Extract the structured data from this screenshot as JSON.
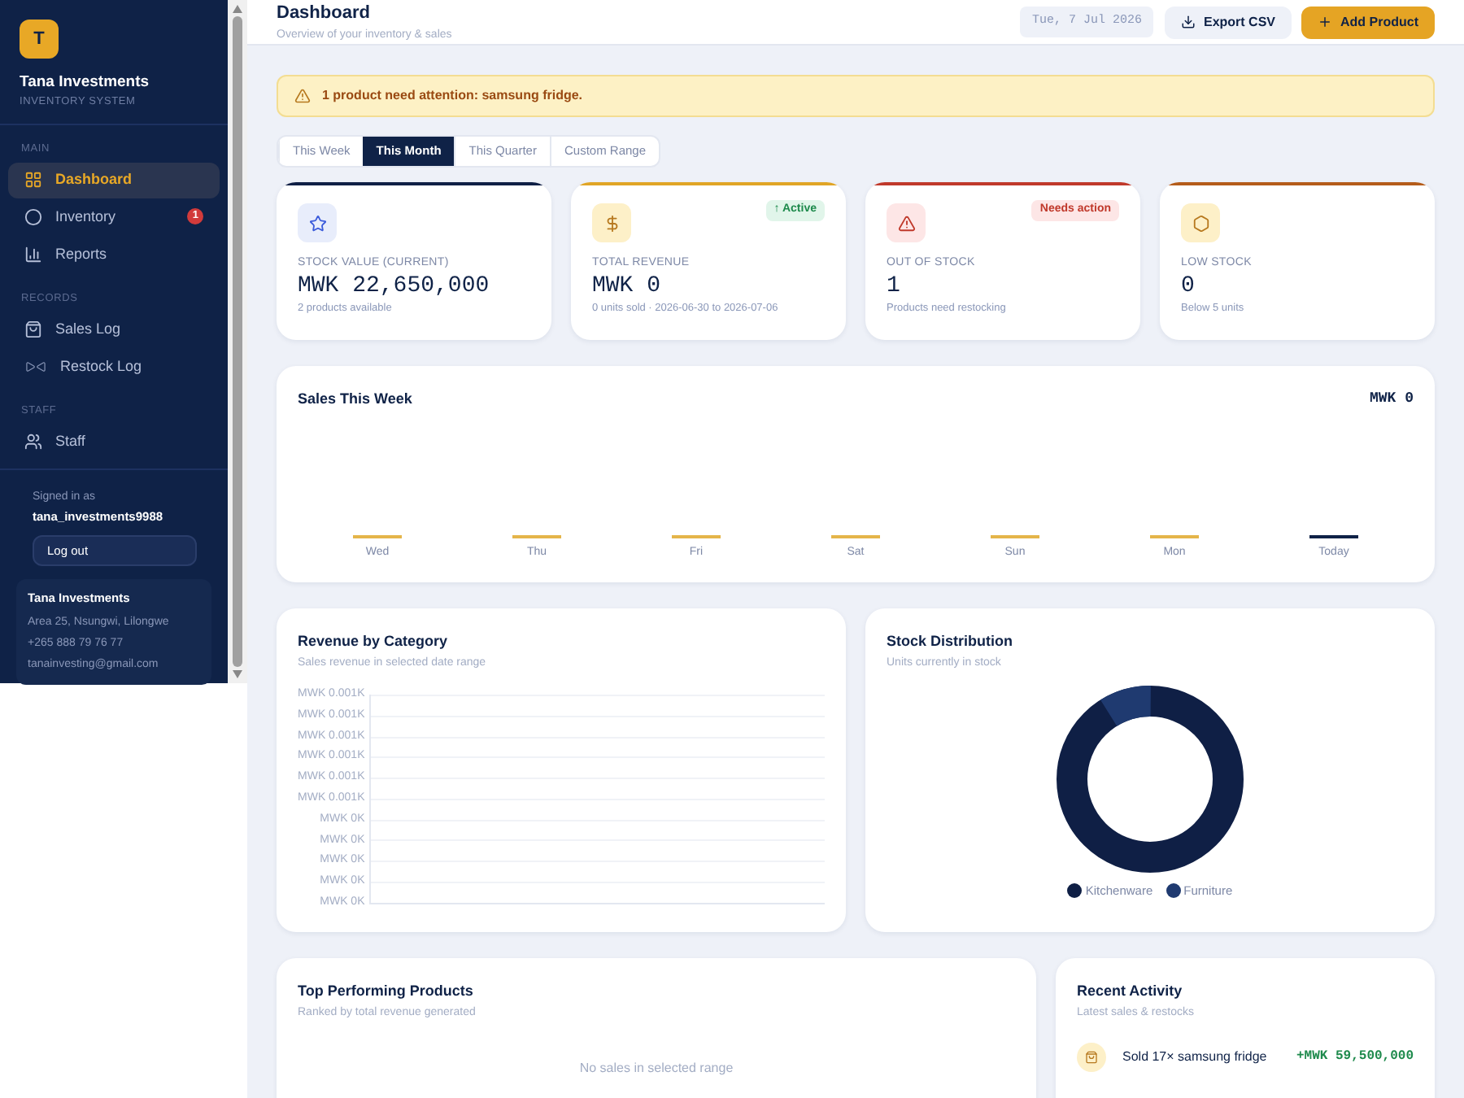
{
  "brand": {
    "logo_letter": "T",
    "name": "Tana Investments",
    "subtitle": "INVENTORY SYSTEM"
  },
  "sidebar": {
    "sections": [
      {
        "heading": "MAIN",
        "items": [
          {
            "label": "Dashboard",
            "kind": "grid",
            "selected": true
          },
          {
            "label": "Inventory",
            "kind": "circle",
            "selected": false,
            "badge": "1"
          },
          {
            "label": "Reports",
            "kind": "bars",
            "selected": false
          }
        ]
      },
      {
        "heading": "RECORDS",
        "items": [
          {
            "label": "Sales Log",
            "kind": "bag",
            "selected": false
          },
          {
            "label": "Restock Log",
            "kind": "arrows",
            "selected": false
          }
        ]
      },
      {
        "heading": "STAFF",
        "items": [
          {
            "label": "Staff",
            "kind": "users",
            "selected": false
          }
        ]
      }
    ],
    "signed_in_label": "Signed in as",
    "username": "tana_investments9988",
    "logout": "Log out",
    "company": {
      "name": "Tana Investments",
      "lines": [
        "Area 25, Nsungwi, Lilongwe",
        "+265 888 79 76 77",
        "tanainvesting@gmail.com"
      ]
    }
  },
  "header": {
    "title": "Dashboard",
    "subtitle": "Overview of your inventory & sales",
    "date": "Tue, 7 Jul 2026",
    "export": "Export CSV",
    "add": "Add Product"
  },
  "alert": "1 product need attention: samsung fridge.",
  "tabs": [
    {
      "label": "This Week",
      "selected": false
    },
    {
      "label": "This Month",
      "selected": true
    },
    {
      "label": "This Quarter",
      "selected": false
    },
    {
      "label": "Custom Range",
      "selected": false
    }
  ],
  "stats": [
    {
      "kind": "star",
      "color": "#0f1f45",
      "label": "STOCK VALUE (CURRENT)",
      "value": "MWK 22,650,000",
      "note": "2 products available"
    },
    {
      "kind": "dollar",
      "color": "#e0a526",
      "label": "TOTAL REVENUE",
      "value": "MWK 0",
      "note": "0 units sold · 2026-06-30 to 2026-07-06",
      "tag": {
        "text": "↑ Active",
        "kind": "good"
      }
    },
    {
      "kind": "warning",
      "color": "#c0392b",
      "label": "OUT OF STOCK",
      "value": "1",
      "note": "Products need restocking",
      "tag": {
        "text": "Needs action",
        "kind": "bad"
      }
    },
    {
      "kind": "hexagon",
      "color": "#b45c1a",
      "label": "LOW STOCK",
      "value": "0",
      "note": "Below 5 units"
    }
  ],
  "sales_week": {
    "title": "Sales This Week",
    "total": "MWK 0",
    "days": [
      {
        "label": "Wed",
        "selected": false
      },
      {
        "label": "Thu",
        "selected": false
      },
      {
        "label": "Fri",
        "selected": false
      },
      {
        "label": "Sat",
        "selected": false
      },
      {
        "label": "Sun",
        "selected": false
      },
      {
        "label": "Mon",
        "selected": false
      },
      {
        "label": "Today",
        "selected": true
      }
    ]
  },
  "revenue_by_category": {
    "title": "Revenue by Category",
    "subtitle": "Sales revenue in selected date range",
    "y_labels": [
      "MWK 0.001K",
      "MWK 0.001K",
      "MWK 0.001K",
      "MWK 0.001K",
      "MWK 0.001K",
      "MWK 0.001K",
      "MWK 0K",
      "MWK 0K",
      "MWK 0K",
      "MWK 0K",
      "MWK 0K"
    ]
  },
  "stock_distribution": {
    "title": "Stock Distribution",
    "subtitle": "Units currently in stock",
    "legend": [
      {
        "label": "Kitchenware",
        "color": "#0f1f45"
      },
      {
        "label": "Furniture",
        "color": "#1f3a70"
      }
    ]
  },
  "top_products": {
    "title": "Top Performing Products",
    "subtitle": "Ranked by total revenue generated",
    "empty": "No sales in selected range"
  },
  "recent_activity": {
    "title": "Recent Activity",
    "subtitle": "Latest sales & restocks",
    "items": [
      {
        "text": "Sold 17× samsung fridge",
        "amount": "+MWK 59,500,000"
      }
    ]
  }
}
